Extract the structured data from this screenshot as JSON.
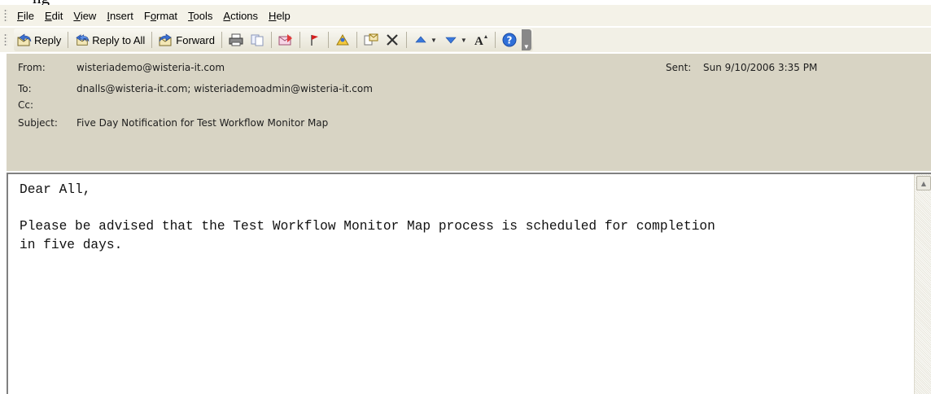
{
  "top_text": "ng",
  "menu": [
    "File",
    "Edit",
    "View",
    "Insert",
    "Format",
    "Tools",
    "Actions",
    "Help"
  ],
  "menu_accel": [
    "F",
    "E",
    "V",
    "I",
    "o",
    "T",
    "A",
    "H"
  ],
  "toolbar": {
    "reply_label": "Reply",
    "reply_all_label": "Reply to All",
    "forward_label": "Forward"
  },
  "header": {
    "from_label": "From:",
    "from_value": "wisteriademo@wisteria-it.com",
    "sent_label": "Sent:",
    "sent_value": "Sun 9/10/2006 3:35 PM",
    "to_label": "To:",
    "to_value": "dnalls@wisteria-it.com; wisteriademoadmin@wisteria-it.com",
    "cc_label": "Cc:",
    "cc_value": "",
    "subject_label": "Subject:",
    "subject_value": "Five Day Notification for Test Workflow Monitor Map"
  },
  "message": {
    "greeting": "Dear All,",
    "body": "Please be advised that the Test Workflow Monitor Map process is scheduled for completion\nin five days."
  },
  "icons": [
    "reply-icon",
    "reply-all-icon",
    "forward-icon",
    "print-icon",
    "copy-icon",
    "move-icon",
    "flag-icon",
    "contacts-icon",
    "categories-icon",
    "delete-icon",
    "previous-item-icon",
    "next-item-icon",
    "font-size-icon",
    "help-icon"
  ]
}
